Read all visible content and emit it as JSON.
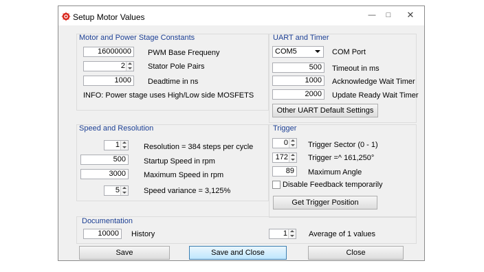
{
  "window": {
    "title": "Setup Motor Values",
    "minimize": "—",
    "maximize": "□",
    "close": "✕"
  },
  "motor": {
    "title": "Motor and Power Stage Constants",
    "pwm_value": "16000000",
    "pwm_label": "PWM Base Frequeny",
    "pole_value": "2",
    "pole_label": "Stator Pole Pairs",
    "deadtime_value": "1000",
    "deadtime_label": "Deadtime in ns",
    "info": "INFO: Power stage uses High/Low side MOSFETS"
  },
  "uart": {
    "title": "UART and Timer",
    "com_value": "COM5",
    "com_label": "COM Port",
    "timeout_value": "500",
    "timeout_label": "Timeout in ms",
    "ack_value": "1000",
    "ack_label": "Acknowledge Wait Timer",
    "update_value": "2000",
    "update_label": "Update Ready Wait Timer",
    "defaults_button": "Other UART Default Settings"
  },
  "speed": {
    "title": "Speed and Resolution",
    "resolution_value": "1",
    "resolution_label": "Resolution = 384 steps per cycle",
    "startup_value": "500",
    "startup_label": "Startup Speed in rpm",
    "max_value": "3000",
    "max_label": "Maximum Speed in rpm",
    "variance_value": "5",
    "variance_label": "Speed variance = 3,125%"
  },
  "trigger": {
    "title": "Trigger",
    "sector_value": "0",
    "sector_label": "Trigger Sector (0 - 1)",
    "angle_value": "172",
    "angle_label": "Trigger =^ 161,250°",
    "max_angle_value": "89",
    "max_angle_label": "Maximum Angle",
    "disable_feedback_label": "Disable Feedback temporarily",
    "disable_feedback_checked": false,
    "get_position_button": "Get Trigger Position"
  },
  "documentation": {
    "title": "Documentation",
    "history_value": "10000",
    "history_label": "History",
    "average_value": "1",
    "average_label": "Average of 1 values"
  },
  "buttons": {
    "save": "Save",
    "save_close": "Save and Close",
    "close": "Close"
  },
  "colors": {
    "accent": "#1c3f94",
    "icon": "#d9261c"
  }
}
